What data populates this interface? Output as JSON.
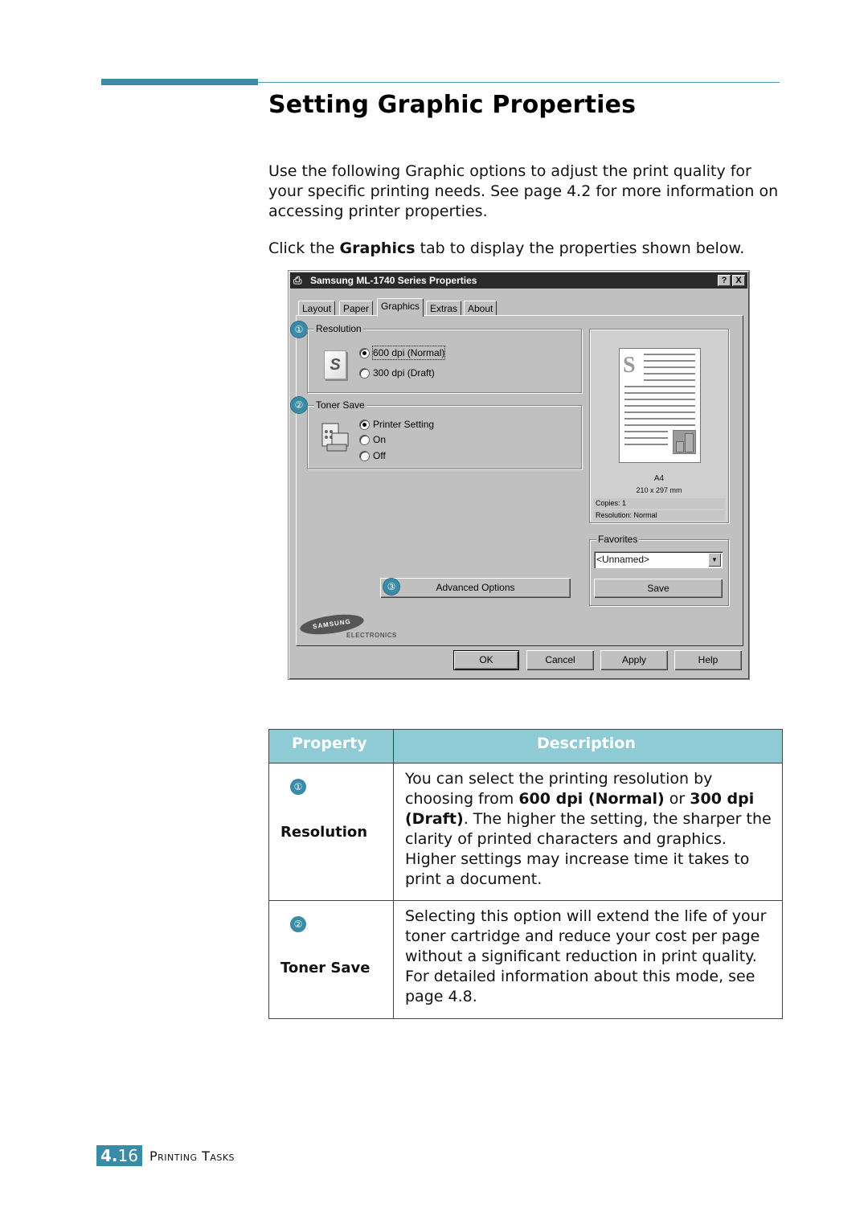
{
  "header": {
    "title": "Setting Graphic Properties"
  },
  "intro": {
    "paragraph1": "Use the following Graphic options to adjust the print quality for your specific printing needs. See page 4.2 for more information on accessing printer properties.",
    "paragraph2_prefix": "Click the ",
    "paragraph2_bold": "Graphics",
    "paragraph2_suffix": " tab to display the properties shown below."
  },
  "dialog": {
    "title": "Samsung ML-1740 Series Properties",
    "help_button": "?",
    "close_button": "X",
    "tabs": [
      {
        "label": "Layout",
        "active": false
      },
      {
        "label": "Paper",
        "active": false
      },
      {
        "label": "Graphics",
        "active": true
      },
      {
        "label": "Extras",
        "active": false
      },
      {
        "label": "About",
        "active": false
      }
    ],
    "resolution": {
      "badge": "①",
      "label": "Resolution",
      "options": [
        {
          "label": "600 dpi (Normal)",
          "selected": true
        },
        {
          "label": "300 dpi (Draft)",
          "selected": false
        }
      ]
    },
    "toner_save": {
      "badge": "②",
      "label": "Toner Save",
      "options": [
        {
          "label": "Printer Setting",
          "selected": true
        },
        {
          "label": "On",
          "selected": false
        },
        {
          "label": "Off",
          "selected": false
        }
      ]
    },
    "preview": {
      "paper_size": "A4",
      "dimensions": "210 x 297 mm",
      "copies": "Copies: 1",
      "resolution": "Resolution: Normal"
    },
    "favorites": {
      "label": "Favorites",
      "selected": "<Unnamed>",
      "save_label": "Save"
    },
    "advanced": {
      "badge": "③",
      "label": "Advanced Options"
    },
    "logo": {
      "brand": "SAMSUNG",
      "sub": "ELECTRONICS"
    },
    "buttons": {
      "ok": "OK",
      "cancel": "Cancel",
      "apply": "Apply",
      "help": "Help"
    }
  },
  "table": {
    "headers": {
      "property": "Property",
      "description": "Description"
    },
    "rows": [
      {
        "badge": "①",
        "property": "Resolution",
        "desc_parts": [
          "You can select the printing resolution by choosing from ",
          "600 dpi (Normal)",
          " or ",
          "300 dpi (Draft)",
          ". The higher the setting, the sharper the clarity of printed characters and graphics. Higher settings may increase time it takes to print a document."
        ]
      },
      {
        "badge": "②",
        "property": "Toner Save",
        "description": "Selecting this option will extend the life of your toner cartridge and reduce your cost per page without a significant reduction in print quality. For detailed information about this mode, see page 4.8."
      }
    ]
  },
  "footer": {
    "chapter": "4.",
    "page": "16",
    "section": "Printing Tasks"
  },
  "colors": {
    "accent": "#3a8ba6",
    "table_header": "#8ecbd4",
    "dialog_face": "#c0c0c0"
  }
}
